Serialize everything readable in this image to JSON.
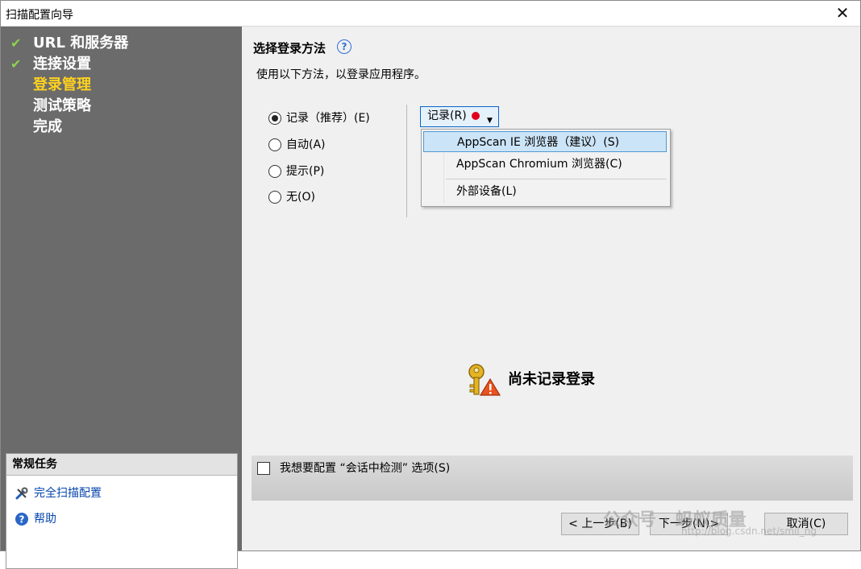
{
  "window": {
    "title": "扫描配置向导",
    "close_icon": "close-icon"
  },
  "sidebar": {
    "steps": [
      {
        "label": "URL 和服务器",
        "done": true
      },
      {
        "label": "连接设置",
        "done": true
      },
      {
        "label": "登录管理",
        "current": true
      },
      {
        "label": "测试策略"
      },
      {
        "label": "完成"
      }
    ],
    "tasks": {
      "header": "常规任务",
      "items": [
        {
          "label": "完全扫描配置",
          "icon": "tools-icon"
        },
        {
          "label": "帮助",
          "icon": "help-icon"
        }
      ]
    }
  },
  "main": {
    "title": "选择登录方法",
    "description": "使用以下方法，以登录应用程序。",
    "options": [
      {
        "label": "记录（推荐）(E)",
        "checked": true
      },
      {
        "label": "自动(A)",
        "checked": false
      },
      {
        "label": "提示(P)",
        "checked": false
      },
      {
        "label": "无(O)",
        "checked": false
      }
    ],
    "record_button": {
      "label": "记录(R)"
    },
    "menu": [
      "AppScan IE 浏览器（建议）(S)",
      "AppScan Chromium 浏览器(C)",
      "外部设备(L)"
    ],
    "status": "尚未记录登录",
    "session_checkbox": {
      "label": "我想要配置 “会话中检测” 选项(S)",
      "checked": false
    }
  },
  "footer": {
    "back": "< 上一步(B)",
    "next": "下一步(N)>",
    "cancel": "取消(C)"
  },
  "watermark": {
    "main": "公众号 · 蚂蚁质量",
    "sub": "http://blog.csdn.net/smil_ng"
  },
  "colors": {
    "current_step": "#ffd21f",
    "check": "#8fd14f",
    "record_dot": "#e0001b",
    "accent": "#0a64c8"
  }
}
